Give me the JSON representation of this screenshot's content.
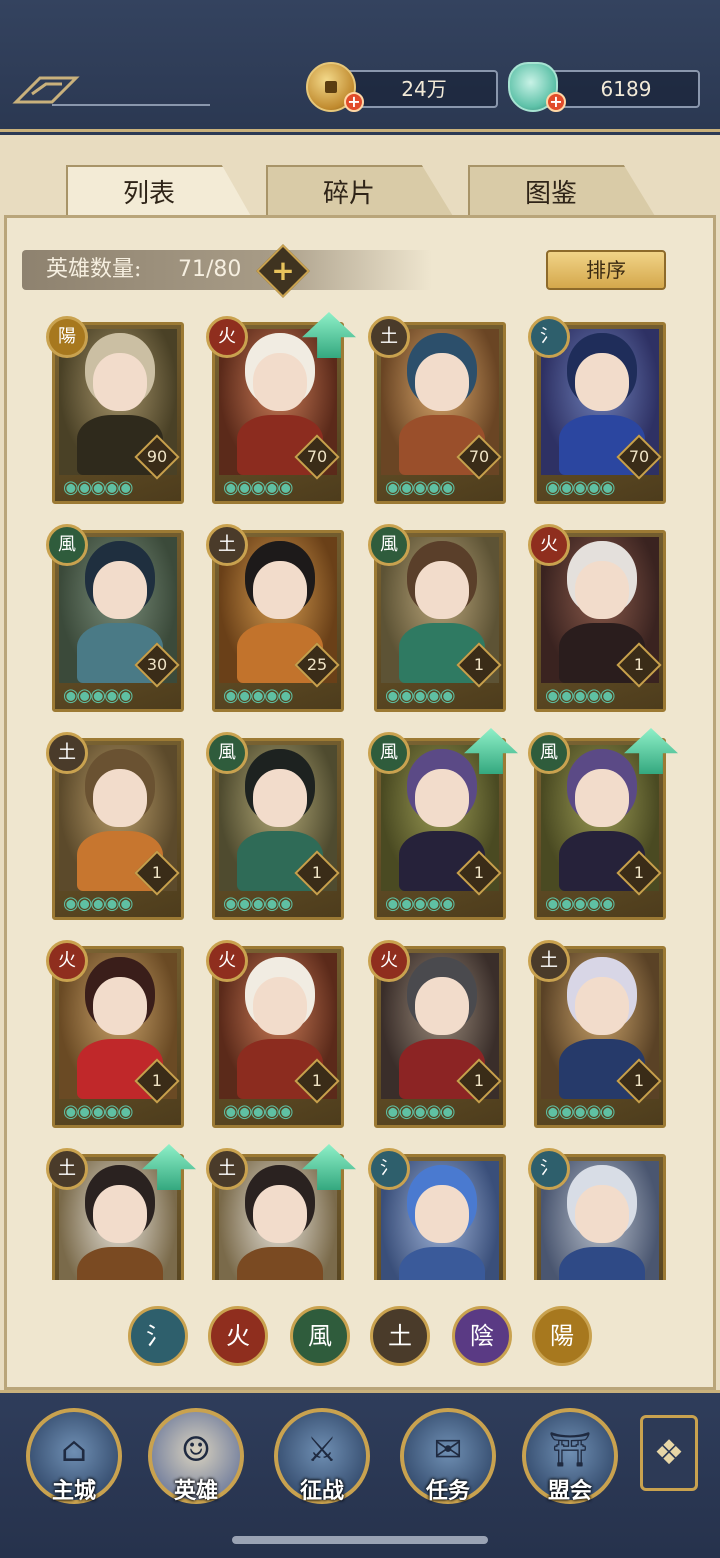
{
  "currencies": {
    "coins": {
      "value": "24万",
      "icon": "coin-icon"
    },
    "jade": {
      "value": "6189",
      "icon": "jade-icon"
    }
  },
  "tabs": [
    {
      "label": "列表",
      "active": true
    },
    {
      "label": "碎片",
      "active": false
    },
    {
      "label": "图鉴",
      "active": false
    }
  ],
  "hero_count": {
    "label": "英雄数量:",
    "value": "71/80"
  },
  "sort_label": "排序",
  "element_glyphs": {
    "water": "氵",
    "fire": "火",
    "wind": "風",
    "earth": "土",
    "yin": "陰",
    "yang": "陽"
  },
  "element_colors": {
    "water": "#2e5f6c",
    "fire": "#8f2e1e",
    "wind": "#2f5c3c",
    "earth": "#4a3b2a",
    "yin": "#5a3a84",
    "yang": "#a7781e"
  },
  "heroes": [
    {
      "element": "yang",
      "level": "90",
      "stars": 5,
      "upgrade": false,
      "palette": [
        "#a6946a",
        "#4a4126",
        "#cbbfa3",
        "#2f2a1c"
      ]
    },
    {
      "element": "fire",
      "level": "70",
      "stars": 5,
      "upgrade": true,
      "palette": [
        "#c97a56",
        "#5b2a1a",
        "#f1ece2",
        "#8c2c1f"
      ]
    },
    {
      "element": "earth",
      "level": "70",
      "stars": 5,
      "upgrade": false,
      "palette": [
        "#d8a66b",
        "#6a4524",
        "#2c4f6b",
        "#9a4f2b"
      ]
    },
    {
      "element": "water",
      "level": "70",
      "stars": 5,
      "upgrade": false,
      "palette": [
        "#6e7fb8",
        "#2e3164",
        "#1f2d5a",
        "#2b46a0"
      ]
    },
    {
      "element": "wind",
      "level": "30",
      "stars": 5,
      "upgrade": false,
      "palette": [
        "#7a8d7a",
        "#3b4a3a",
        "#1f2f3f",
        "#4a7a86"
      ]
    },
    {
      "element": "earth",
      "level": "25",
      "stars": 5,
      "upgrade": false,
      "palette": [
        "#d49a4e",
        "#6a4018",
        "#1d1a1a",
        "#c2732c"
      ]
    },
    {
      "element": "wind",
      "level": "1",
      "stars": 5,
      "upgrade": false,
      "palette": [
        "#b9a57a",
        "#5d5335",
        "#5a3f2a",
        "#2f7a62"
      ]
    },
    {
      "element": "fire",
      "level": "1",
      "stars": 5,
      "upgrade": false,
      "palette": [
        "#8a5a4a",
        "#3a2320",
        "#e4e0dc",
        "#2a1d1d"
      ]
    },
    {
      "element": "earth",
      "level": "1",
      "stars": 5,
      "upgrade": false,
      "palette": [
        "#b99d6a",
        "#5c4a2b",
        "#6a5232",
        "#c7762f"
      ]
    },
    {
      "element": "wind",
      "level": "1",
      "stars": 5,
      "upgrade": false,
      "palette": [
        "#b3a977",
        "#4f4b2f",
        "#1d2220",
        "#2f6b57"
      ]
    },
    {
      "element": "wind",
      "level": "1",
      "stars": 5,
      "upgrade": true,
      "palette": [
        "#9a9a54",
        "#4a4a22",
        "#5b4a86",
        "#26223a"
      ]
    },
    {
      "element": "wind",
      "level": "1",
      "stars": 5,
      "upgrade": true,
      "palette": [
        "#9a9a54",
        "#4a4a22",
        "#5b4a86",
        "#26223a"
      ]
    },
    {
      "element": "fire",
      "level": "1",
      "stars": 5,
      "upgrade": false,
      "palette": [
        "#c9a26a",
        "#6a4a24",
        "#3a1e1a",
        "#c0282a"
      ]
    },
    {
      "element": "fire",
      "level": "1",
      "stars": 5,
      "upgrade": false,
      "palette": [
        "#c97a56",
        "#5b2a1a",
        "#f1ece2",
        "#8c2c1f"
      ]
    },
    {
      "element": "fire",
      "level": "1",
      "stars": 5,
      "upgrade": false,
      "palette": [
        "#9a8a7a",
        "#3a2e2a",
        "#4a4a4e",
        "#8c2424"
      ]
    },
    {
      "element": "earth",
      "level": "1",
      "stars": 5,
      "upgrade": false,
      "palette": [
        "#c9a26a",
        "#5a4226",
        "#d8d6e6",
        "#263a6a"
      ]
    },
    {
      "element": "earth",
      "level": "",
      "stars": 0,
      "upgrade": true,
      "palette": [
        "#e6e2da",
        "#7a6a4a",
        "#2a2220",
        "#7a4a22"
      ]
    },
    {
      "element": "earth",
      "level": "",
      "stars": 0,
      "upgrade": true,
      "palette": [
        "#e6e2da",
        "#7a6a4a",
        "#2a2220",
        "#7a4a22"
      ]
    },
    {
      "element": "water",
      "level": "",
      "stars": 0,
      "upgrade": false,
      "palette": [
        "#9fb3d8",
        "#3a4f7a",
        "#4a7ad0",
        "#3a5a9a"
      ]
    },
    {
      "element": "water",
      "level": "",
      "stars": 0,
      "upgrade": false,
      "palette": [
        "#b8c0cc",
        "#4a5670",
        "#d8dde6",
        "#2f4a86"
      ]
    }
  ],
  "filters": [
    "water",
    "fire",
    "wind",
    "earth",
    "yin",
    "yang"
  ],
  "nav": [
    {
      "label": "主城",
      "icon": "city-icon",
      "glyph": "⌂",
      "active": false
    },
    {
      "label": "英雄",
      "icon": "hero-icon",
      "glyph": "☺",
      "active": true
    },
    {
      "label": "征战",
      "icon": "battle-icon",
      "glyph": "⚔",
      "active": false
    },
    {
      "label": "任务",
      "icon": "quest-icon",
      "glyph": "✉",
      "active": false
    },
    {
      "label": "盟会",
      "icon": "guild-icon",
      "glyph": "⛩",
      "active": false
    }
  ],
  "menu_icon": "menu-icon"
}
